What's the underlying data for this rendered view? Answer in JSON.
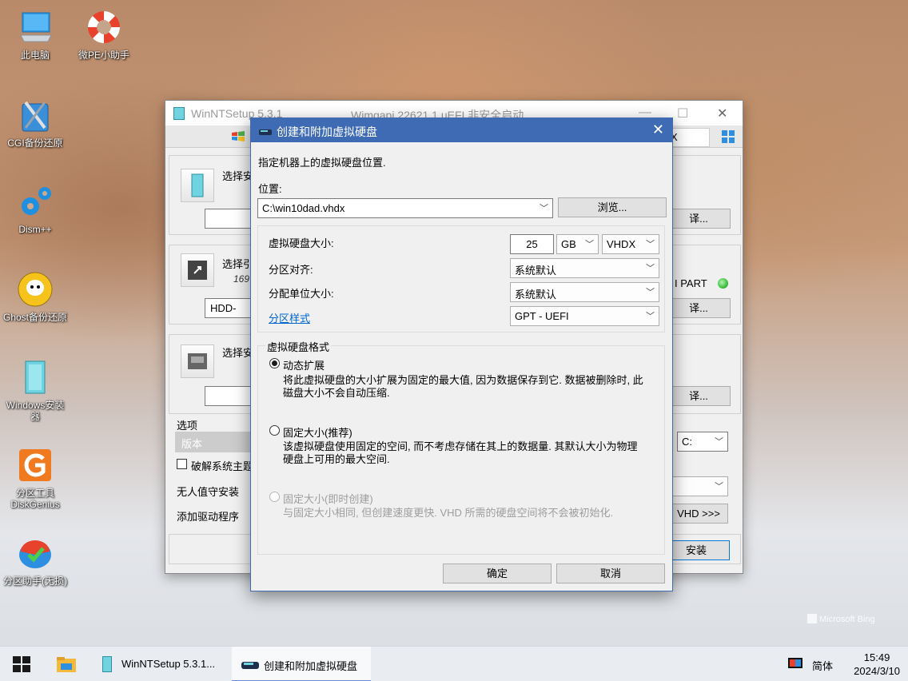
{
  "desktop": {
    "icons": [
      {
        "label": "此电脑"
      },
      {
        "label": "微PE小助手"
      },
      {
        "label": "CGI备份还原"
      },
      {
        "label": "Dism++"
      },
      {
        "label": "Ghost备份还原"
      },
      {
        "label": "Windows安装器"
      },
      {
        "label": "分区工具DiskGenius"
      },
      {
        "label": "分区助手(无损)"
      }
    ],
    "watermark": "Microsoft Bing"
  },
  "main_window": {
    "title": "WinNTSetup 5.3.1",
    "subtitle": "Wimgapi 22621.1   uEFI 非安全启动",
    "tab_field": "X",
    "section1_label": "选择安",
    "section2_label": "选择引",
    "section2_sub": "169",
    "section2_field": "HDD-",
    "section2_status": "I PART",
    "section3_label": "选择安",
    "options_label": "选项",
    "version_label": "版本",
    "crack_label": "破解系统主题",
    "unattended_label": "无人值守安装",
    "add_driver_label": "添加驱动程序",
    "drive_combo": "C:",
    "vhd_button": "VHD >>>",
    "install_button": "安装",
    "select_btn_partial": "译..."
  },
  "dialog": {
    "title": "创建和附加虚拟硬盘",
    "prompt": "指定机器上的虚拟硬盘位置.",
    "location_label": "位置:",
    "location_value": "C:\\win10dad.vhdx",
    "browse_button": "浏览...",
    "size_label": "虚拟硬盘大小:",
    "size_value": "25",
    "size_unit": "GB",
    "disk_type": "VHDX",
    "align_label": "分区对齐:",
    "align_value": "系统默认",
    "alloc_label": "分配单位大小:",
    "alloc_value": "系统默认",
    "partition_style_link": "分区样式",
    "partition_style_value": "GPT - UEFI",
    "format_group_label": "虚拟硬盘格式",
    "option1_label": "动态扩展",
    "option1_desc_line1": "将此虚拟硬盘的大小扩展为固定的最大值, 因为数据保存到它. 数据被删除时, 此",
    "option1_desc_line2": "磁盘大小不会自动压缩.",
    "option2_label": "固定大小(推荐)",
    "option2_desc_line1": "该虚拟硬盘使用固定的空间, 而不考虑存储在其上的数据量. 其默认大小为物理",
    "option2_desc_line2": "硬盘上可用的最大空间.",
    "option3_label": "固定大小(即时创建)",
    "option3_desc": "与固定大小相同, 但创建速度更快. VHD 所需的硬盘空间将不会被初始化.",
    "ok_button": "确定",
    "cancel_button": "取消"
  },
  "taskbar": {
    "items": [
      {
        "label": "WinNTSetup 5.3.1..."
      },
      {
        "label": "创建和附加虚拟硬盘"
      }
    ],
    "ime": "简体",
    "time": "15:49",
    "date": "2024/3/10"
  },
  "colors": {
    "dialog_title": "#3e6bb3",
    "link": "#0066cc",
    "status_led": "#3cc23c"
  }
}
